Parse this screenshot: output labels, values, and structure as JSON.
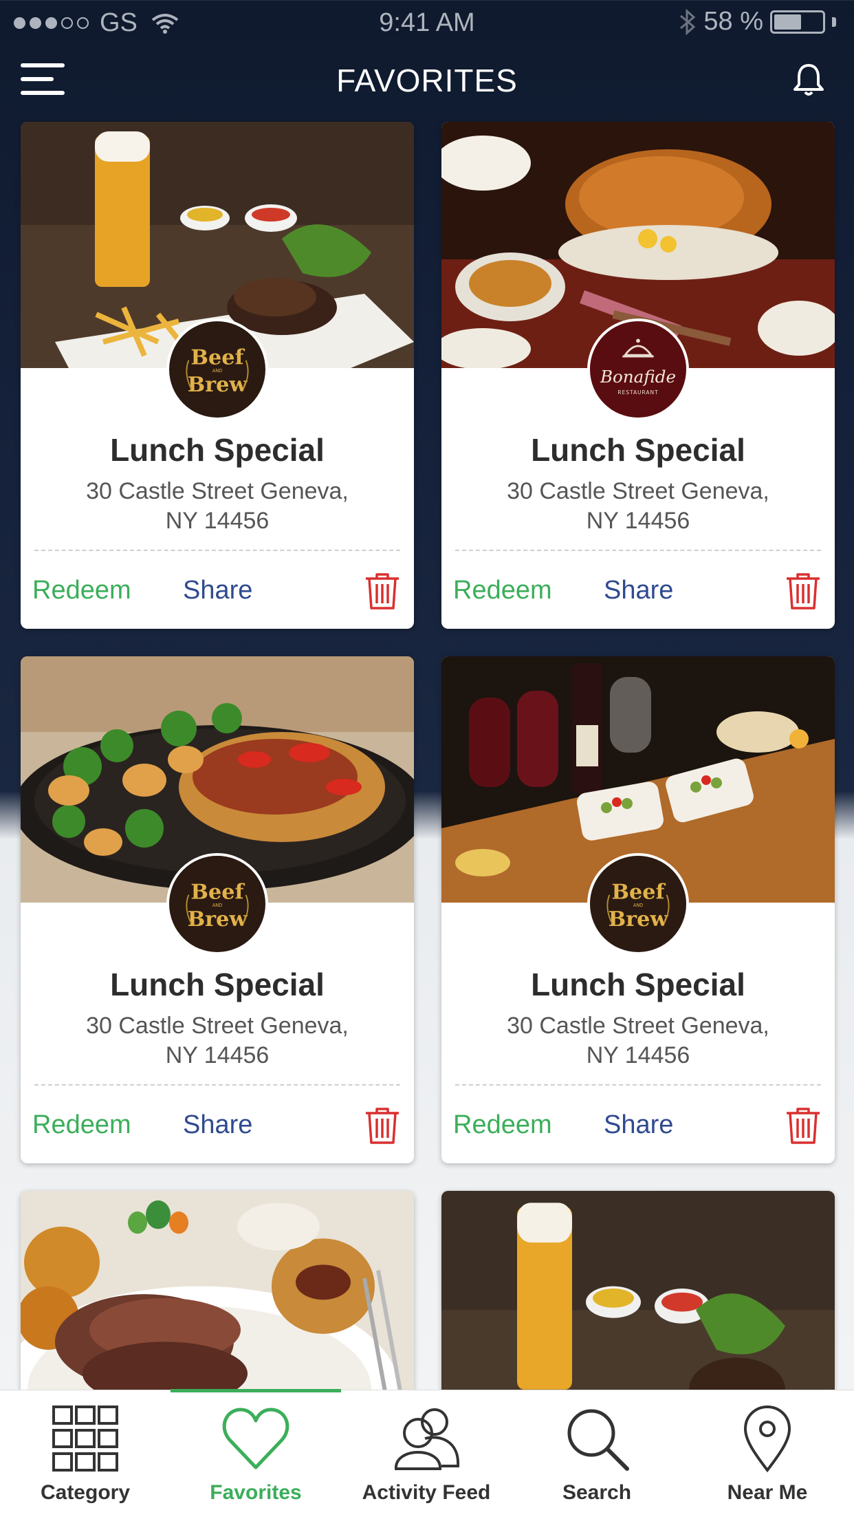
{
  "status_bar": {
    "carrier": "GS",
    "time": "9:41 AM",
    "battery": "58 %",
    "battery_level": 0.58,
    "signal_bars_filled": 3,
    "signal_bars_total": 5
  },
  "nav": {
    "title": "FAVORITES",
    "menu_icon": "hamburger-menu-icon",
    "notification_icon": "bell-icon"
  },
  "colors": {
    "accent_green": "#3bae5a",
    "share_blue": "#2f4a8f",
    "delete_red": "#d9302f",
    "nav_background": "#0f1a2e"
  },
  "favorites": [
    {
      "logo": "Beef and Brew",
      "title": "Lunch Special",
      "address_line1": "30 Castle Street Geneva,",
      "address_line2": "NY 14456",
      "redeem_label": "Redeem",
      "share_label": "Share",
      "delete_icon": "trash-icon"
    },
    {
      "logo": "Bonafide Restaurant",
      "title": "Lunch Special",
      "address_line1": "30 Castle Street Geneva,",
      "address_line2": "NY 14456",
      "redeem_label": "Redeem",
      "share_label": "Share",
      "delete_icon": "trash-icon"
    },
    {
      "logo": "Beef and Brew",
      "title": "Lunch Special",
      "address_line1": "30 Castle Street Geneva,",
      "address_line2": "NY 14456",
      "redeem_label": "Redeem",
      "share_label": "Share",
      "delete_icon": "trash-icon"
    },
    {
      "logo": "Beef and Brew",
      "title": "Lunch Special",
      "address_line1": "30 Castle Street Geneva,",
      "address_line2": "NY 14456",
      "redeem_label": "Redeem",
      "share_label": "Share",
      "delete_icon": "trash-icon"
    }
  ],
  "logo_text": {
    "beef_top": "Beef",
    "beef_and": "AND",
    "beef_bottom": "Brew",
    "bonafide_name": "Bonafide",
    "bonafide_sub": "RESTAURANT"
  },
  "tabbar": {
    "active": "Favorites",
    "tabs": [
      {
        "label": "Category",
        "icon": "grid-icon"
      },
      {
        "label": "Favorites",
        "icon": "heart-icon"
      },
      {
        "label": "Activity Feed",
        "icon": "users-icon"
      },
      {
        "label": "Search",
        "icon": "search-icon"
      },
      {
        "label": "Near Me",
        "icon": "location-pin-icon"
      }
    ]
  }
}
